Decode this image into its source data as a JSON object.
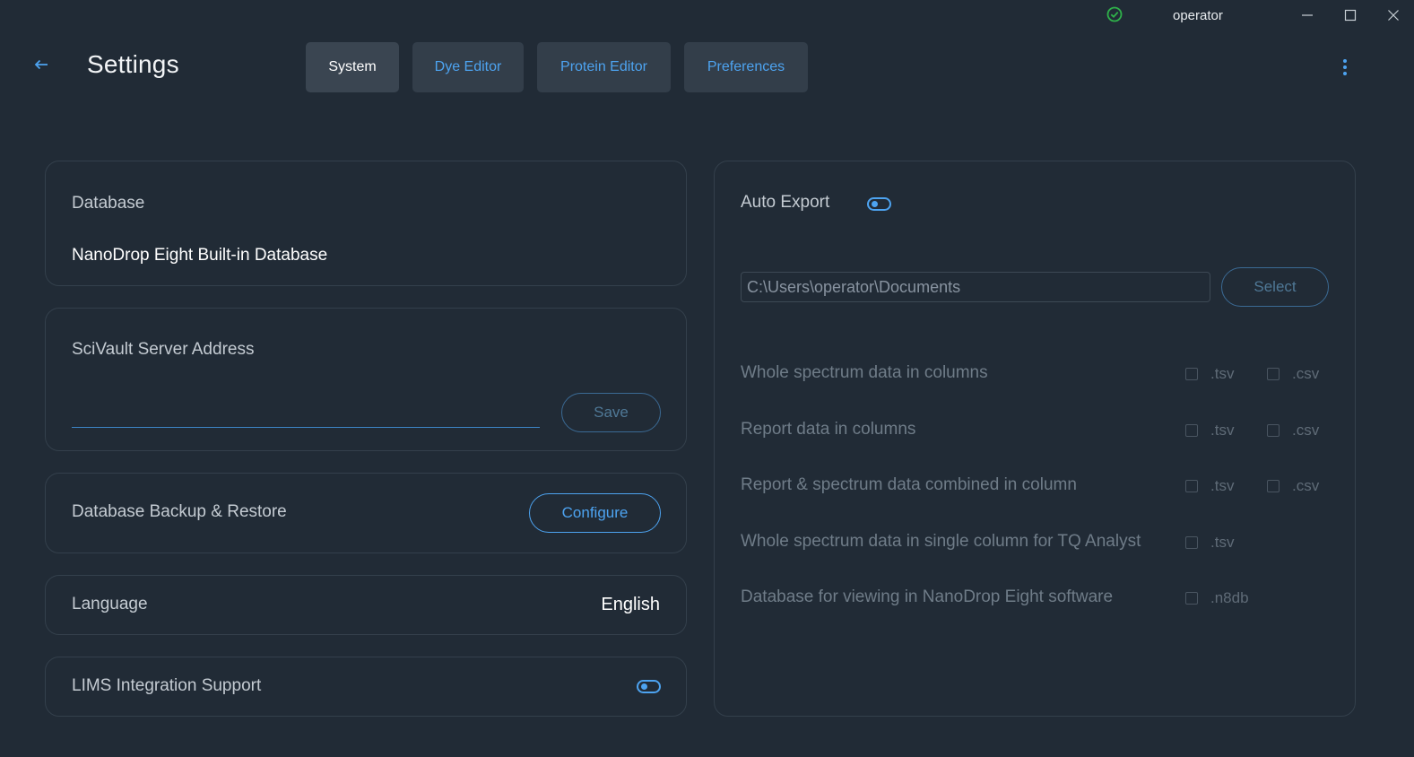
{
  "titlebar": {
    "user": "operator"
  },
  "header": {
    "title": "Settings"
  },
  "tabs": [
    {
      "label": "System",
      "active": true
    },
    {
      "label": "Dye Editor",
      "active": false
    },
    {
      "label": "Protein Editor",
      "active": false
    },
    {
      "label": "Preferences",
      "active": false
    }
  ],
  "database": {
    "label": "Database",
    "value": "NanoDrop Eight Built-in Database"
  },
  "scivault": {
    "label": "SciVault Server Address",
    "input_value": "",
    "save_label": "Save"
  },
  "backup": {
    "label": "Database Backup & Restore",
    "button_label": "Configure"
  },
  "language": {
    "label": "Language",
    "value": "English"
  },
  "lims": {
    "label": "LIMS Integration Support",
    "enabled": false
  },
  "auto_export": {
    "label": "Auto Export",
    "enabled": false,
    "path": "C:\\Users\\operator\\Documents",
    "select_label": "Select",
    "rows": [
      {
        "label": "Whole spectrum data in columns",
        "options": [
          ".tsv",
          ".csv"
        ]
      },
      {
        "label": "Report data in columns",
        "options": [
          ".tsv",
          ".csv"
        ]
      },
      {
        "label": "Report & spectrum data combined in column",
        "options": [
          ".tsv",
          ".csv"
        ]
      },
      {
        "label": "Whole spectrum data in single column for TQ Analyst",
        "options": [
          ".tsv"
        ]
      },
      {
        "label": "Database for viewing in NanoDrop Eight software",
        "options": [
          ".n8db"
        ]
      }
    ]
  },
  "colors": {
    "background": "#212b36",
    "accent": "#4da3f0",
    "status_ok": "#2fb14a"
  }
}
